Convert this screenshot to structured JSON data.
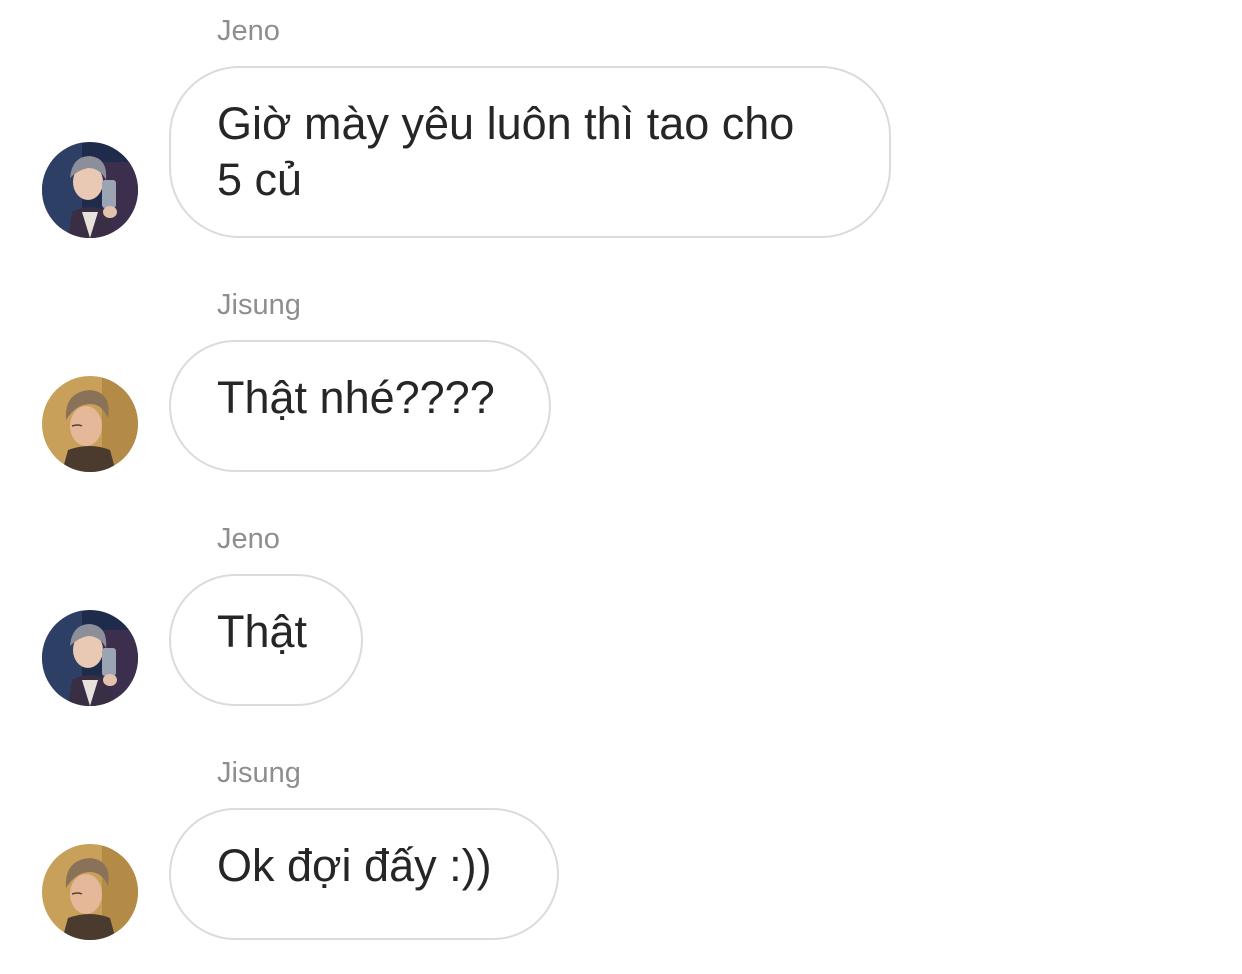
{
  "conversation": {
    "messages": [
      {
        "sender": "Jeno",
        "text": "Giờ mày yêu luôn thì tao cho\n5 củ",
        "avatar_icon": "jeno-avatar-icon"
      },
      {
        "sender": "Jisung",
        "text": "Thật nhé????",
        "avatar_icon": "jisung-avatar-icon"
      },
      {
        "sender": "Jeno",
        "text": "Thật",
        "avatar_icon": "jeno-avatar-icon"
      },
      {
        "sender": "Jisung",
        "text": "Ok đợi đấy :))",
        "avatar_icon": "jisung-avatar-icon"
      }
    ]
  },
  "colors": {
    "sender_name": "#8e8e8e",
    "bubble_border": "#dbdbdb",
    "message_text": "#262626",
    "background": "#ffffff"
  }
}
